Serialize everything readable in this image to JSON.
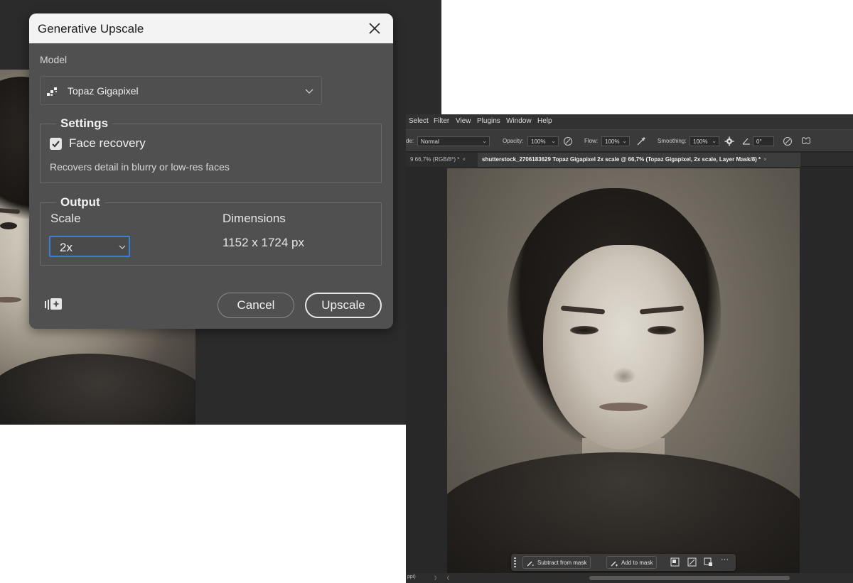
{
  "dialog": {
    "title": "Generative Upscale",
    "model_label": "Model",
    "model_value": "Topaz Gigapixel",
    "settings": {
      "legend": "Settings",
      "face_recovery_label": "Face recovery",
      "face_recovery_checked": true,
      "description": "Recovers detail in blurry or low-res faces"
    },
    "output": {
      "legend": "Output",
      "scale_label": "Scale",
      "scale_value": "2x",
      "dimensions_label": "Dimensions",
      "dimensions_value": "1152 x 1724 px"
    },
    "cancel_label": "Cancel",
    "upscale_label": "Upscale"
  },
  "photoshop": {
    "menu": [
      "Select",
      "Filter",
      "View",
      "Plugins",
      "Window",
      "Help"
    ],
    "options": {
      "mode_label": "de:",
      "mode_value": "Normal",
      "opacity_label": "Opacity:",
      "opacity_value": "100%",
      "flow_label": "Flow:",
      "flow_value": "100%",
      "smoothing_label": "Smoothing:",
      "smoothing_value": "100%",
      "angle_value": "0°"
    },
    "tabs": [
      {
        "label": "9 66,7% (RGB/8*) *",
        "close": "×"
      },
      {
        "label": "shutterstock_2706183629 Topaz Gigapixel 2x scale @ 66,7% (Topaz Gigapixel, 2x scale, Layer Mask/8) *",
        "close": "×"
      }
    ],
    "taskbar": {
      "subtract_label": "Subtract from mask",
      "add_label": "Add to mask",
      "more_label": "···"
    },
    "status": {
      "left_text": "ppi)",
      "nav_next": "〉",
      "nav_prev": "〈"
    }
  }
}
